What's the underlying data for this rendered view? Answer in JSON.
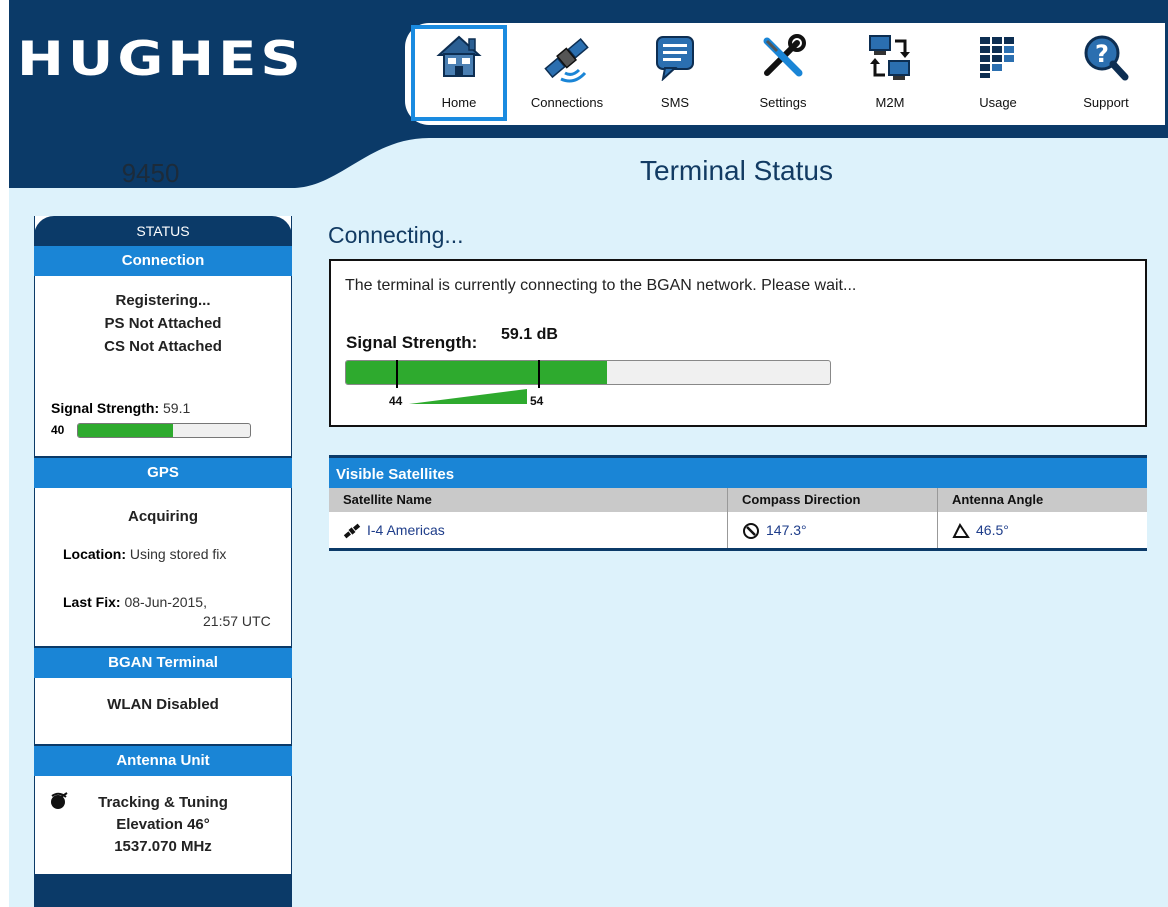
{
  "header": {
    "logo_text": "HUGHES",
    "model": "9450",
    "page_title": "Terminal Status",
    "nav": [
      {
        "label": "Home",
        "icon": "home-icon",
        "active": true
      },
      {
        "label": "Connections",
        "icon": "satellite-icon"
      },
      {
        "label": "SMS",
        "icon": "sms-icon"
      },
      {
        "label": "Settings",
        "icon": "wrench-screwdriver-icon"
      },
      {
        "label": "M2M",
        "icon": "m2m-computers-icon"
      },
      {
        "label": "Usage",
        "icon": "usage-grid-icon"
      },
      {
        "label": "Support",
        "icon": "support-magnifier-icon"
      }
    ]
  },
  "sidebar": {
    "status_title": "STATUS",
    "connection": {
      "title": "Connection",
      "state": "Registering...",
      "ps": "PS Not Attached",
      "cs": "CS Not Attached",
      "signal_label": "Signal Strength:",
      "signal_value": "59.1",
      "signal_min": "40",
      "signal_fraction": 0.55
    },
    "gps": {
      "title": "GPS",
      "state": "Acquiring",
      "location_label": "Location:",
      "location_value": "Using stored fix",
      "lastfix_label": "Last Fix:",
      "lastfix_date": "08-Jun-2015,",
      "lastfix_time": "21:57 UTC"
    },
    "bgan": {
      "title": "BGAN Terminal",
      "wlan": "WLAN Disabled"
    },
    "antenna": {
      "title": "Antenna Unit",
      "icon": "antenna-satellite-icon",
      "line1": "Tracking & Tuning",
      "line2": "Elevation 46°",
      "line3": "1537.070 MHz"
    }
  },
  "main": {
    "heading": "Connecting...",
    "message": "The terminal is currently connecting to the BGAN network. Please wait...",
    "signal_label": "Signal Strength:",
    "signal_value": "59.1 dB",
    "signal_fraction": 0.54,
    "tick_low": "44",
    "tick_high": "54",
    "accent_green": "#2eaa2e"
  },
  "satellites": {
    "title": "Visible Satellites",
    "columns": [
      "Satellite Name",
      "Compass Direction",
      "Antenna Angle"
    ],
    "rows": [
      {
        "name": "I-4 Americas",
        "compass": "147.3°",
        "angle": "46.5°"
      }
    ]
  },
  "colors": {
    "navy": "#0b3a68",
    "blue": "#1a85d6",
    "background": "#ddf2fb"
  }
}
